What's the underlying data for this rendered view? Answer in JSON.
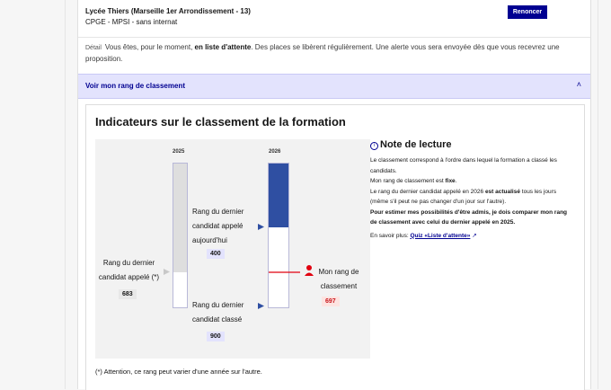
{
  "header": {
    "school": "Lycée Thiers (Marseille 1er Arrondissement - 13)",
    "program": "CPGE - MPSI - sans internat",
    "renounce_label": "Renoncer"
  },
  "detail": {
    "label": "Détail",
    "text_before": "Vous êtes, pour le moment, ",
    "status": "en liste d'attente",
    "text_after": ". Des places se libèrent régulièrement. Une alerte vous sera envoyée dès que vous recevrez une proposition."
  },
  "accordion": {
    "label": "Voir mon rang de classement",
    "expanded": true
  },
  "panel": {
    "title": "Indicateurs sur le classement de la formation",
    "chart": {
      "year_prev": "2025",
      "year_curr": "2026",
      "last_called_prev_label": "Rang du dernier candidat appelé (*)",
      "last_called_prev_value": "683",
      "last_called_today_label": "Rang du dernier candidat appelé aujourd'hui",
      "last_called_today_value": "400",
      "last_ranked_label": "Rang du dernier candidat classé",
      "last_ranked_value": "900",
      "my_rank_label": "Mon rang de classement",
      "my_rank_value": "697",
      "colors": {
        "prev_fill": "#dedede",
        "curr_fill": "#2f4fa2",
        "my_rank": "#e1000f"
      }
    },
    "note": {
      "title": "Note de lecture",
      "p1": "Le classement correspond à l'ordre dans lequel la formation a classé les candidats.",
      "p2_prefix": "Mon rang de classement est ",
      "p2_bold": "fixe",
      "p2_suffix": ".",
      "p3_prefix": "Le rang du dernier candidat appelé en 2026 ",
      "p3_bold": "est actualisé",
      "p3_suffix": " tous les jours (même s'il peut ne pas changer d'un jour sur l'autre).",
      "p4": "Pour estimer mes possibilités d'être admis, je dois comparer mon rang de classement avec celui du dernier appelé en 2025.",
      "more_label": "En savoir plus:",
      "more_link": "Quiz «Liste d'attente»"
    },
    "footnote": "(*) Attention, ce rang peut varier d'une année sur l'autre."
  }
}
